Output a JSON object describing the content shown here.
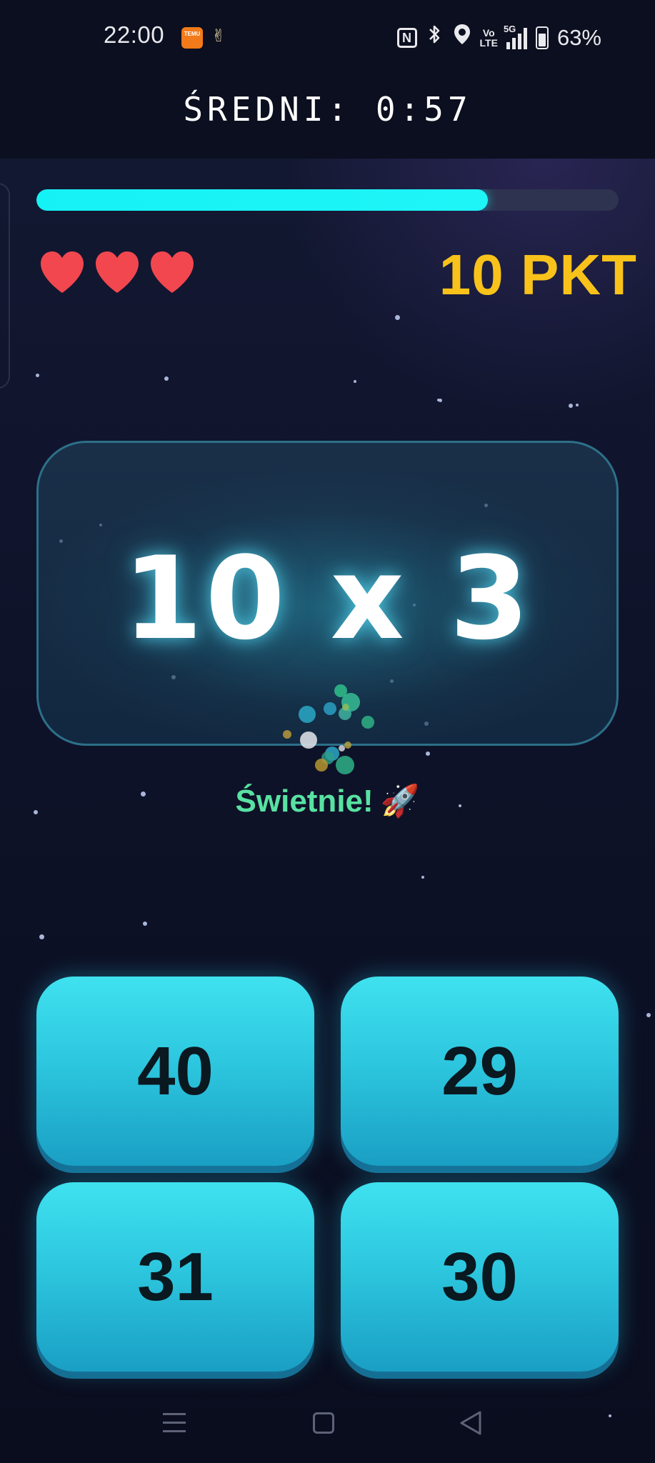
{
  "status_bar": {
    "time": "22:00",
    "app_badge": "TEMU",
    "battery": "63%",
    "network": "5G",
    "volte": [
      "Vo",
      "LTE"
    ],
    "icons": [
      "temu-app-icon",
      "notification-icon",
      "nfc-icon",
      "bluetooth-icon",
      "location-icon",
      "volte-icon",
      "signal-5g-icon",
      "battery-icon"
    ]
  },
  "header": {
    "title": "ŚREDNI: 0:57"
  },
  "game": {
    "progress": 0.775,
    "lives": 3,
    "score": "10 PKT",
    "question": "10 x 3",
    "feedback": "Świetnie!",
    "feedback_emoji": "🚀",
    "answers": [
      "40",
      "29",
      "31",
      "30"
    ]
  },
  "colors": {
    "accent_cyan": "#1ef5f7",
    "score_yellow": "#f8c21b",
    "heart_red": "#f2474f",
    "feedback_green": "#58e2a2",
    "button_cyan": "#2dc7df"
  },
  "navbar": {
    "icons": [
      "menu-icon",
      "home-icon",
      "back-icon"
    ]
  }
}
